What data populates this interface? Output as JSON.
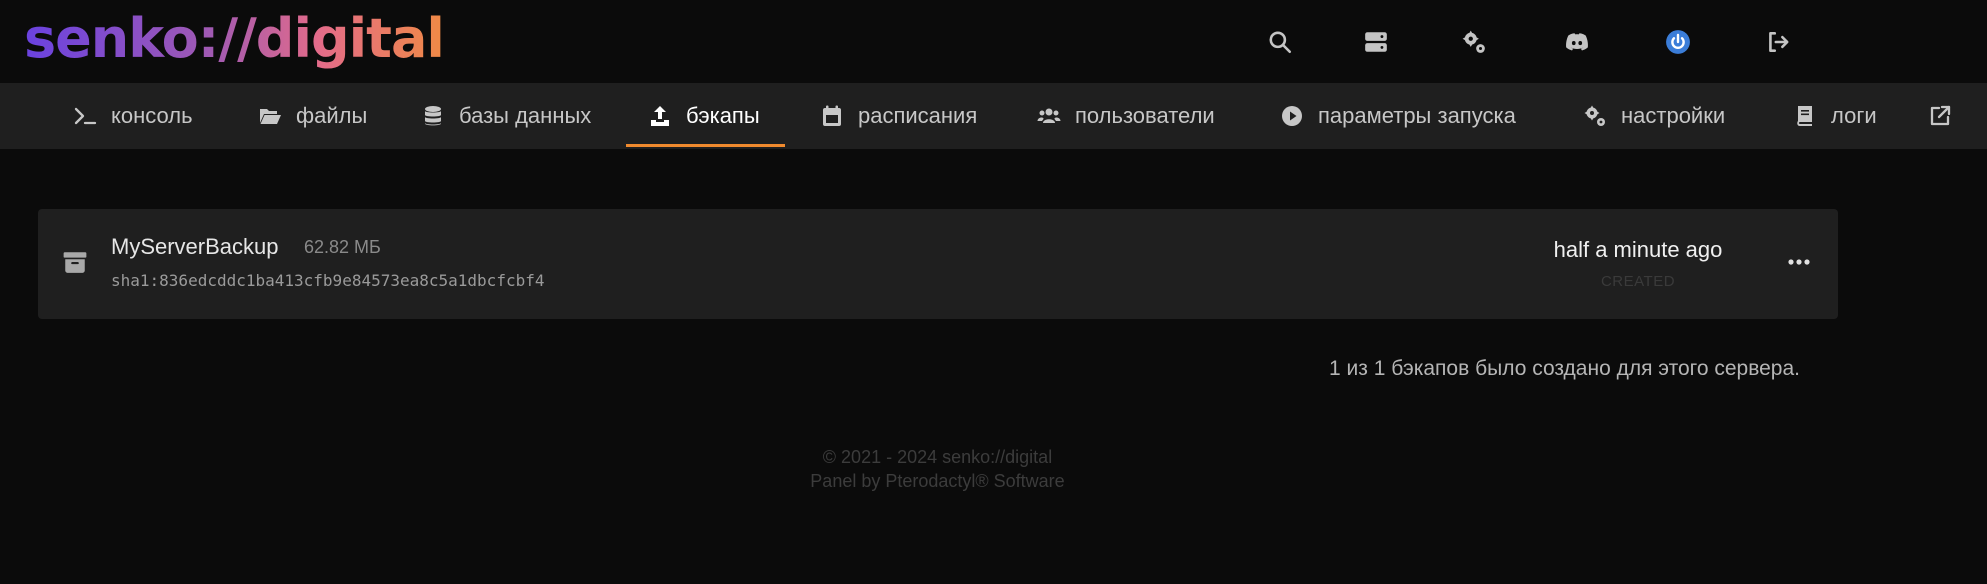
{
  "brand": {
    "logo_text": "senko://digital"
  },
  "header": {
    "icons": [
      "search-icon",
      "servers-icon",
      "admin-cogs-icon",
      "discord-icon",
      "power-icon",
      "logout-icon"
    ]
  },
  "nav": {
    "tabs": [
      {
        "label": "консоль",
        "icon": "terminal-icon"
      },
      {
        "label": "файлы",
        "icon": "folder-open-icon"
      },
      {
        "label": "базы данных",
        "icon": "database-icon"
      },
      {
        "label": "бэкапы",
        "icon": "upload-icon",
        "active": true
      },
      {
        "label": "расписания",
        "icon": "calendar-icon"
      },
      {
        "label": "пользователи",
        "icon": "users-icon"
      },
      {
        "label": "параметры запуска",
        "icon": "play-circle-icon"
      },
      {
        "label": "настройки",
        "icon": "cogs-icon"
      },
      {
        "label": "логи",
        "icon": "book-icon"
      }
    ],
    "external_icon": "external-link-icon",
    "accent_color": "#f08a2e"
  },
  "backup": {
    "name": "MyServerBackup",
    "size": "62.82 МБ",
    "checksum": "sha1:836edcddc1ba413cfb9e84573ea8c5a1dbcfcbf4",
    "time": "half a minute ago",
    "created_label": "CREATED"
  },
  "summary": {
    "count_text": "1 из 1 бэкапов было создано для этого сервера."
  },
  "footer": {
    "copyright": "© 2021 - 2024 senko://digital",
    "panel_credit": "Panel by Pterodactyl® Software"
  }
}
